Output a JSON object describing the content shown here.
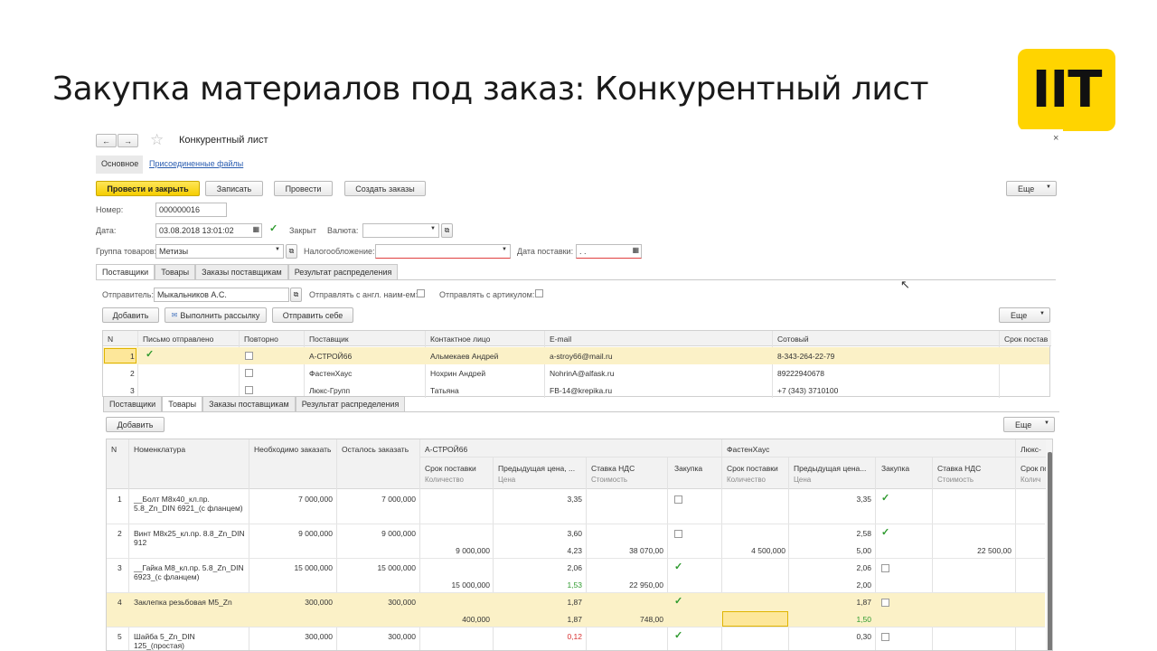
{
  "slide": {
    "title": "Закупка материалов под заказ: Конкурентный лист",
    "logo": "IIT"
  },
  "window": {
    "title": "Конкурентный лист",
    "nav": {
      "back": "←",
      "forward": "→",
      "star": "☆",
      "close": "×"
    },
    "tabs_top": [
      "Основное",
      "Присоединенные файлы"
    ],
    "toolbar": {
      "post_close": "Провести и закрыть",
      "save": "Записать",
      "post": "Провести",
      "create_orders": "Создать заказы",
      "more": "Еще"
    },
    "form": {
      "number_label": "Номер:",
      "number": "000000016",
      "date_label": "Дата:",
      "date": "03.08.2018 13:01:02",
      "closed_label": "Закрыт",
      "currency_label": "Валюта:",
      "group_label": "Группа товаров:",
      "group": "Метизы",
      "tax_label": "Налогообложение:",
      "delivery_date_label": "Дата поставки:",
      "delivery_date": " .  ."
    },
    "mid_tabs": [
      "Поставщики",
      "Товары",
      "Заказы поставщикам",
      "Результат распределения"
    ],
    "sender": {
      "label": "Отправитель:",
      "value": "Мыкальников А.С.",
      "send_eng_label": "Отправлять с англ. наим-ем:",
      "send_article_label": "Отправлять с артикулом:"
    },
    "suppliers_toolbar": {
      "add": "Добавить",
      "mailing": "Выполнить рассылку",
      "send_self": "Отправить себе",
      "more": "Еще"
    },
    "suppliers": {
      "headers": [
        "N",
        "Письмо отправлено",
        "Повторно",
        "Поставщик",
        "Контактное лицо",
        "E-mail",
        "Сотовый",
        "Срок постав"
      ],
      "rows": [
        {
          "n": "1",
          "sent": true,
          "name": "А-СТРОЙ66",
          "contact": "Альмекаев Андрей",
          "email": "a-stroy66@mail.ru",
          "phone": "8-343-264-22-79"
        },
        {
          "n": "2",
          "sent": false,
          "name": "ФастенХаус",
          "contact": "Нохрин Андрей",
          "email": "NohrinA@alfask.ru",
          "phone": "89222940678"
        },
        {
          "n": "3",
          "sent": false,
          "name": "Люкс-Групп",
          "contact": "Татьяна",
          "email": "FB-14@krepika.ru",
          "phone": "+7 (343) 3710100"
        }
      ]
    },
    "bottom_tabs": [
      "Поставщики",
      "Товары",
      "Заказы поставщикам",
      "Результат распределения"
    ],
    "goods_toolbar": {
      "add": "Добавить",
      "more": "Еще"
    },
    "goods": {
      "headers": {
        "n": "N",
        "item": "Номенклатура",
        "need": "Необходимо заказать",
        "left": "Осталось заказать",
        "s1": "А-СТРОЙ66",
        "s2": "ФастенХаус",
        "s3": "Люкс-",
        "term": "Срок поставки",
        "qty": "Количество",
        "prev": "Предыдущая цена, ...",
        "prev2": "Предыдущая цена...",
        "price": "Цена",
        "vat": "Ставка НДС",
        "cost": "Стоимость",
        "buy": "Закупка",
        "term3": "Срок по",
        "qty3": "Колич"
      },
      "rows": [
        {
          "n": "1",
          "item": "__Болт М8х40_кл.пр. 5.8_Zn_DIN 6921_(с фланцем)",
          "need": "7 000,000",
          "left": "7 000,000",
          "a_prev": "3,35",
          "a_qty": "",
          "a_price": "",
          "a_cost": "",
          "a_buy": false,
          "f_prev": "3,35",
          "f_qty": "",
          "f_price": "",
          "f_cost": "",
          "f_buy": true
        },
        {
          "n": "2",
          "item": "Винт М8х25_кл.пр. 8.8_Zn_DIN 912",
          "need": "9 000,000",
          "left": "9 000,000",
          "a_prev": "3,60",
          "a_qty": "9 000,000",
          "a_price": "4,23",
          "a_cost": "38 070,00",
          "a_buy": false,
          "f_prev": "2,58",
          "f_qty": "4 500,000",
          "f_price": "5,00",
          "f_cost": "22 500,00",
          "f_buy": true
        },
        {
          "n": "3",
          "item": "__Гайка М8_кл.пр. 5.8_Zn_DIN 6923_(с фланцем)",
          "need": "15 000,000",
          "left": "15 000,000",
          "a_prev": "2,06",
          "a_qty": "15 000,000",
          "a_price": "1,53",
          "a_cost": "22 950,00",
          "a_buy": true,
          "f_prev": "2,06",
          "f_qty": "",
          "f_price": "2,00",
          "f_cost": "",
          "f_buy": false
        },
        {
          "n": "4",
          "item": "Заклепка резьбовая М5_Zn",
          "need": "300,000",
          "left": "300,000",
          "a_prev": "1,87",
          "a_qty": "400,000",
          "a_price": "1,87",
          "a_cost": "748,00",
          "a_buy": true,
          "f_prev": "1,87",
          "f_qty": "",
          "f_price": "1,50",
          "f_cost": "",
          "f_buy": false
        },
        {
          "n": "5",
          "item": "Шайба 5_Zn_DIN 125_(простая)",
          "need": "300,000",
          "left": "300,000",
          "a_prev": "0,12",
          "a_qty": "",
          "a_price": "",
          "a_cost": "",
          "a_buy": true,
          "f_prev": "0,30",
          "f_qty": "",
          "f_price": "",
          "f_cost": "",
          "f_buy": false
        }
      ]
    }
  }
}
